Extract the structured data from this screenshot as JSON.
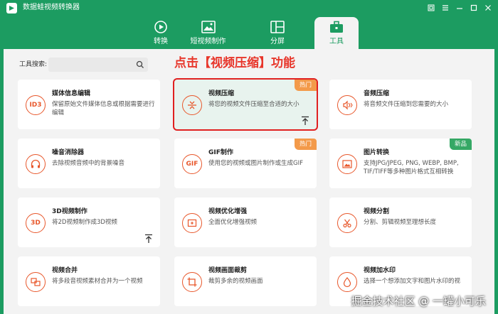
{
  "app": {
    "title": "数据蛙视频转换器"
  },
  "tabs": [
    {
      "label": "转换",
      "icon": "convert-icon"
    },
    {
      "label": "短视频制作",
      "icon": "short-video-icon"
    },
    {
      "label": "分屏",
      "icon": "split-screen-icon"
    },
    {
      "label": "工具",
      "icon": "toolbox-icon"
    }
  ],
  "search": {
    "label": "工具搜索:",
    "value": "",
    "placeholder": ""
  },
  "annotation": "点击【视频压缩】功能",
  "cards": [
    {
      "title": "媒体信息编辑",
      "desc": "保留原始文件媒体信息或根据需要进行编辑",
      "icon": "ID3",
      "badge": ""
    },
    {
      "title": "视频压缩",
      "desc": "将您的视频文件压缩至合适的大小",
      "icon": "compress-icon",
      "badge": "热门"
    },
    {
      "title": "音频压缩",
      "desc": "将音频文件压缩到您需要的大小",
      "icon": "audio-compress-icon",
      "badge": ""
    },
    {
      "title": "噪音消除器",
      "desc": "去除视频音频中的背景噪音",
      "icon": "headphones-icon",
      "badge": ""
    },
    {
      "title": "GIF制作",
      "desc": "使用您的视频或图片制作或生成GIF",
      "icon": "GIF",
      "badge": "热门"
    },
    {
      "title": "图片转换",
      "desc": "支持JPG/JPEG, PNG, WEBP, BMP, TIF/TIFF等多种图片格式互相转换",
      "icon": "image-convert-icon",
      "badge": "新品"
    },
    {
      "title": "3D视频制作",
      "desc": "将2D视频制作成3D视频",
      "icon": "3D",
      "badge": ""
    },
    {
      "title": "视频优化增强",
      "desc": "全面优化增强视频",
      "icon": "enhance-icon",
      "badge": ""
    },
    {
      "title": "视频分割",
      "desc": "分割、剪辑视频至理想长度",
      "icon": "scissors-icon",
      "badge": ""
    },
    {
      "title": "视频合并",
      "desc": "将多段音视频素材合并为一个视频",
      "icon": "merge-icon",
      "badge": ""
    },
    {
      "title": "视频画面裁剪",
      "desc": "裁剪多余的视频画面",
      "icon": "crop-icon",
      "badge": ""
    },
    {
      "title": "视频加水印",
      "desc": "选择一个想添加文字和图片水印的视",
      "icon": "watermark-icon",
      "badge": ""
    }
  ],
  "watermark": "掘金技术社区 @ 一罐小可乐",
  "colors": {
    "brand": "#1c9c61",
    "accent": "#e8572b",
    "hot": "#f39a4a",
    "new": "#35a865",
    "annotation": "#e8362b"
  }
}
